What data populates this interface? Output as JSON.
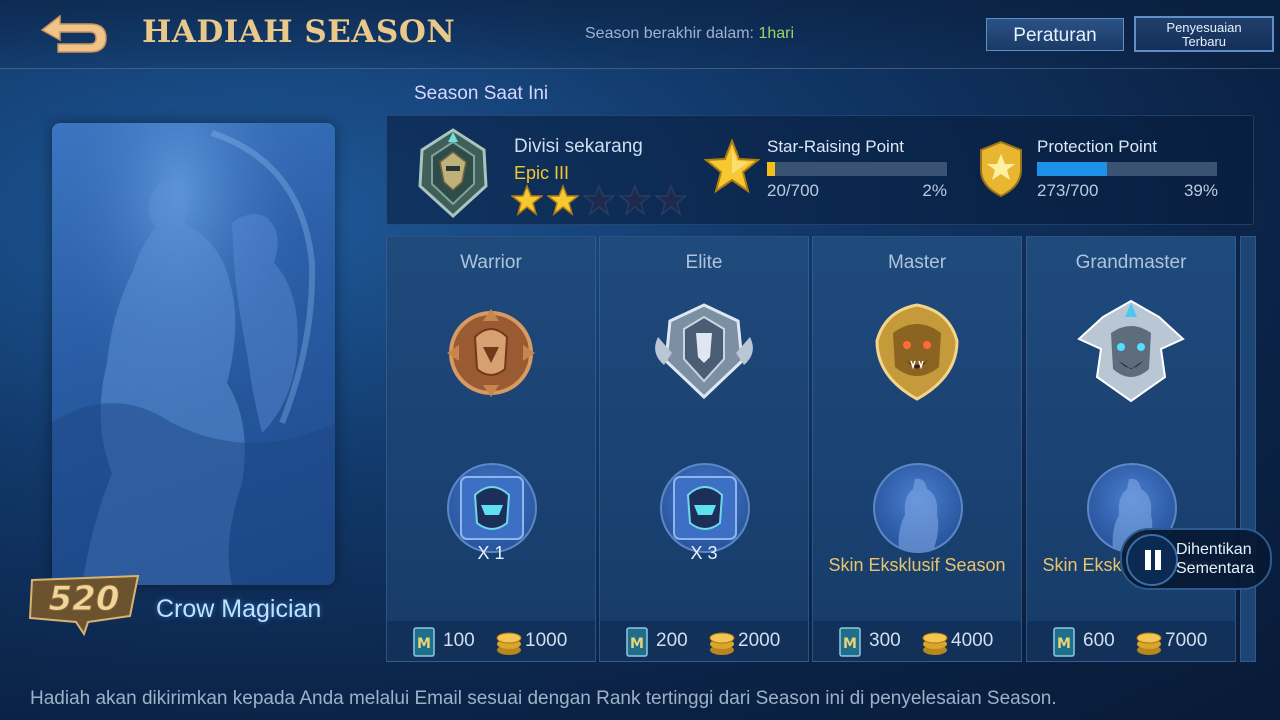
{
  "header": {
    "title": "HADIAH SEASON",
    "season_end_label": "Season berakhir dalam: ",
    "season_end_value": "1hari",
    "rules_button": "Peraturan",
    "adjust_button_line1": "Penyesuaian",
    "adjust_button_line2": "Terbaru"
  },
  "skin": {
    "logo_text": "520",
    "name": "Crow Magician"
  },
  "current_season": {
    "label": "Season Saat Ini",
    "division_label": "Divisi sekarang",
    "division_value": "Epic III",
    "stars_filled": 2,
    "stars_total": 5,
    "star_raising": {
      "label": "Star-Raising Point",
      "value": "20/700",
      "percent_text": "2%",
      "fraction": 0.02,
      "color": "#f2c018"
    },
    "protection": {
      "label": "Protection Point",
      "value": "273/700",
      "percent_text": "39%",
      "fraction": 0.39,
      "color": "#1e90e8"
    }
  },
  "tiers": [
    {
      "name": "Warrior",
      "emblem": "warrior-emblem-icon",
      "reward": "X 1",
      "reward_type": "fragment",
      "tickets": "100",
      "coins": "1000"
    },
    {
      "name": "Elite",
      "emblem": "elite-emblem-icon",
      "reward": "X 3",
      "reward_type": "fragment",
      "tickets": "200",
      "coins": "2000"
    },
    {
      "name": "Master",
      "emblem": "master-emblem-icon",
      "reward": "Skin Eksklusif Season",
      "reward_type": "skin",
      "tickets": "300",
      "coins": "4000"
    },
    {
      "name": "Grandmaster",
      "emblem": "grandmaster-emblem-icon",
      "reward": "Skin Eksklusif Season",
      "reward_type": "skin",
      "tickets": "600",
      "coins": "7000"
    }
  ],
  "overlay": {
    "paused_line1": "Dihentikan",
    "paused_line2": "Sementara"
  },
  "footer": {
    "note": "Hadiah akan dikirimkan kepada Anda melalui Email sesuai dengan Rank tertinggi dari Season ini di penyelesaian Season."
  },
  "colors": {
    "title_gold": "#e8c98a",
    "season_days": "#9ed46a",
    "division_gold": "#f3c530",
    "skin_caption_gold": "#e9c36a"
  }
}
